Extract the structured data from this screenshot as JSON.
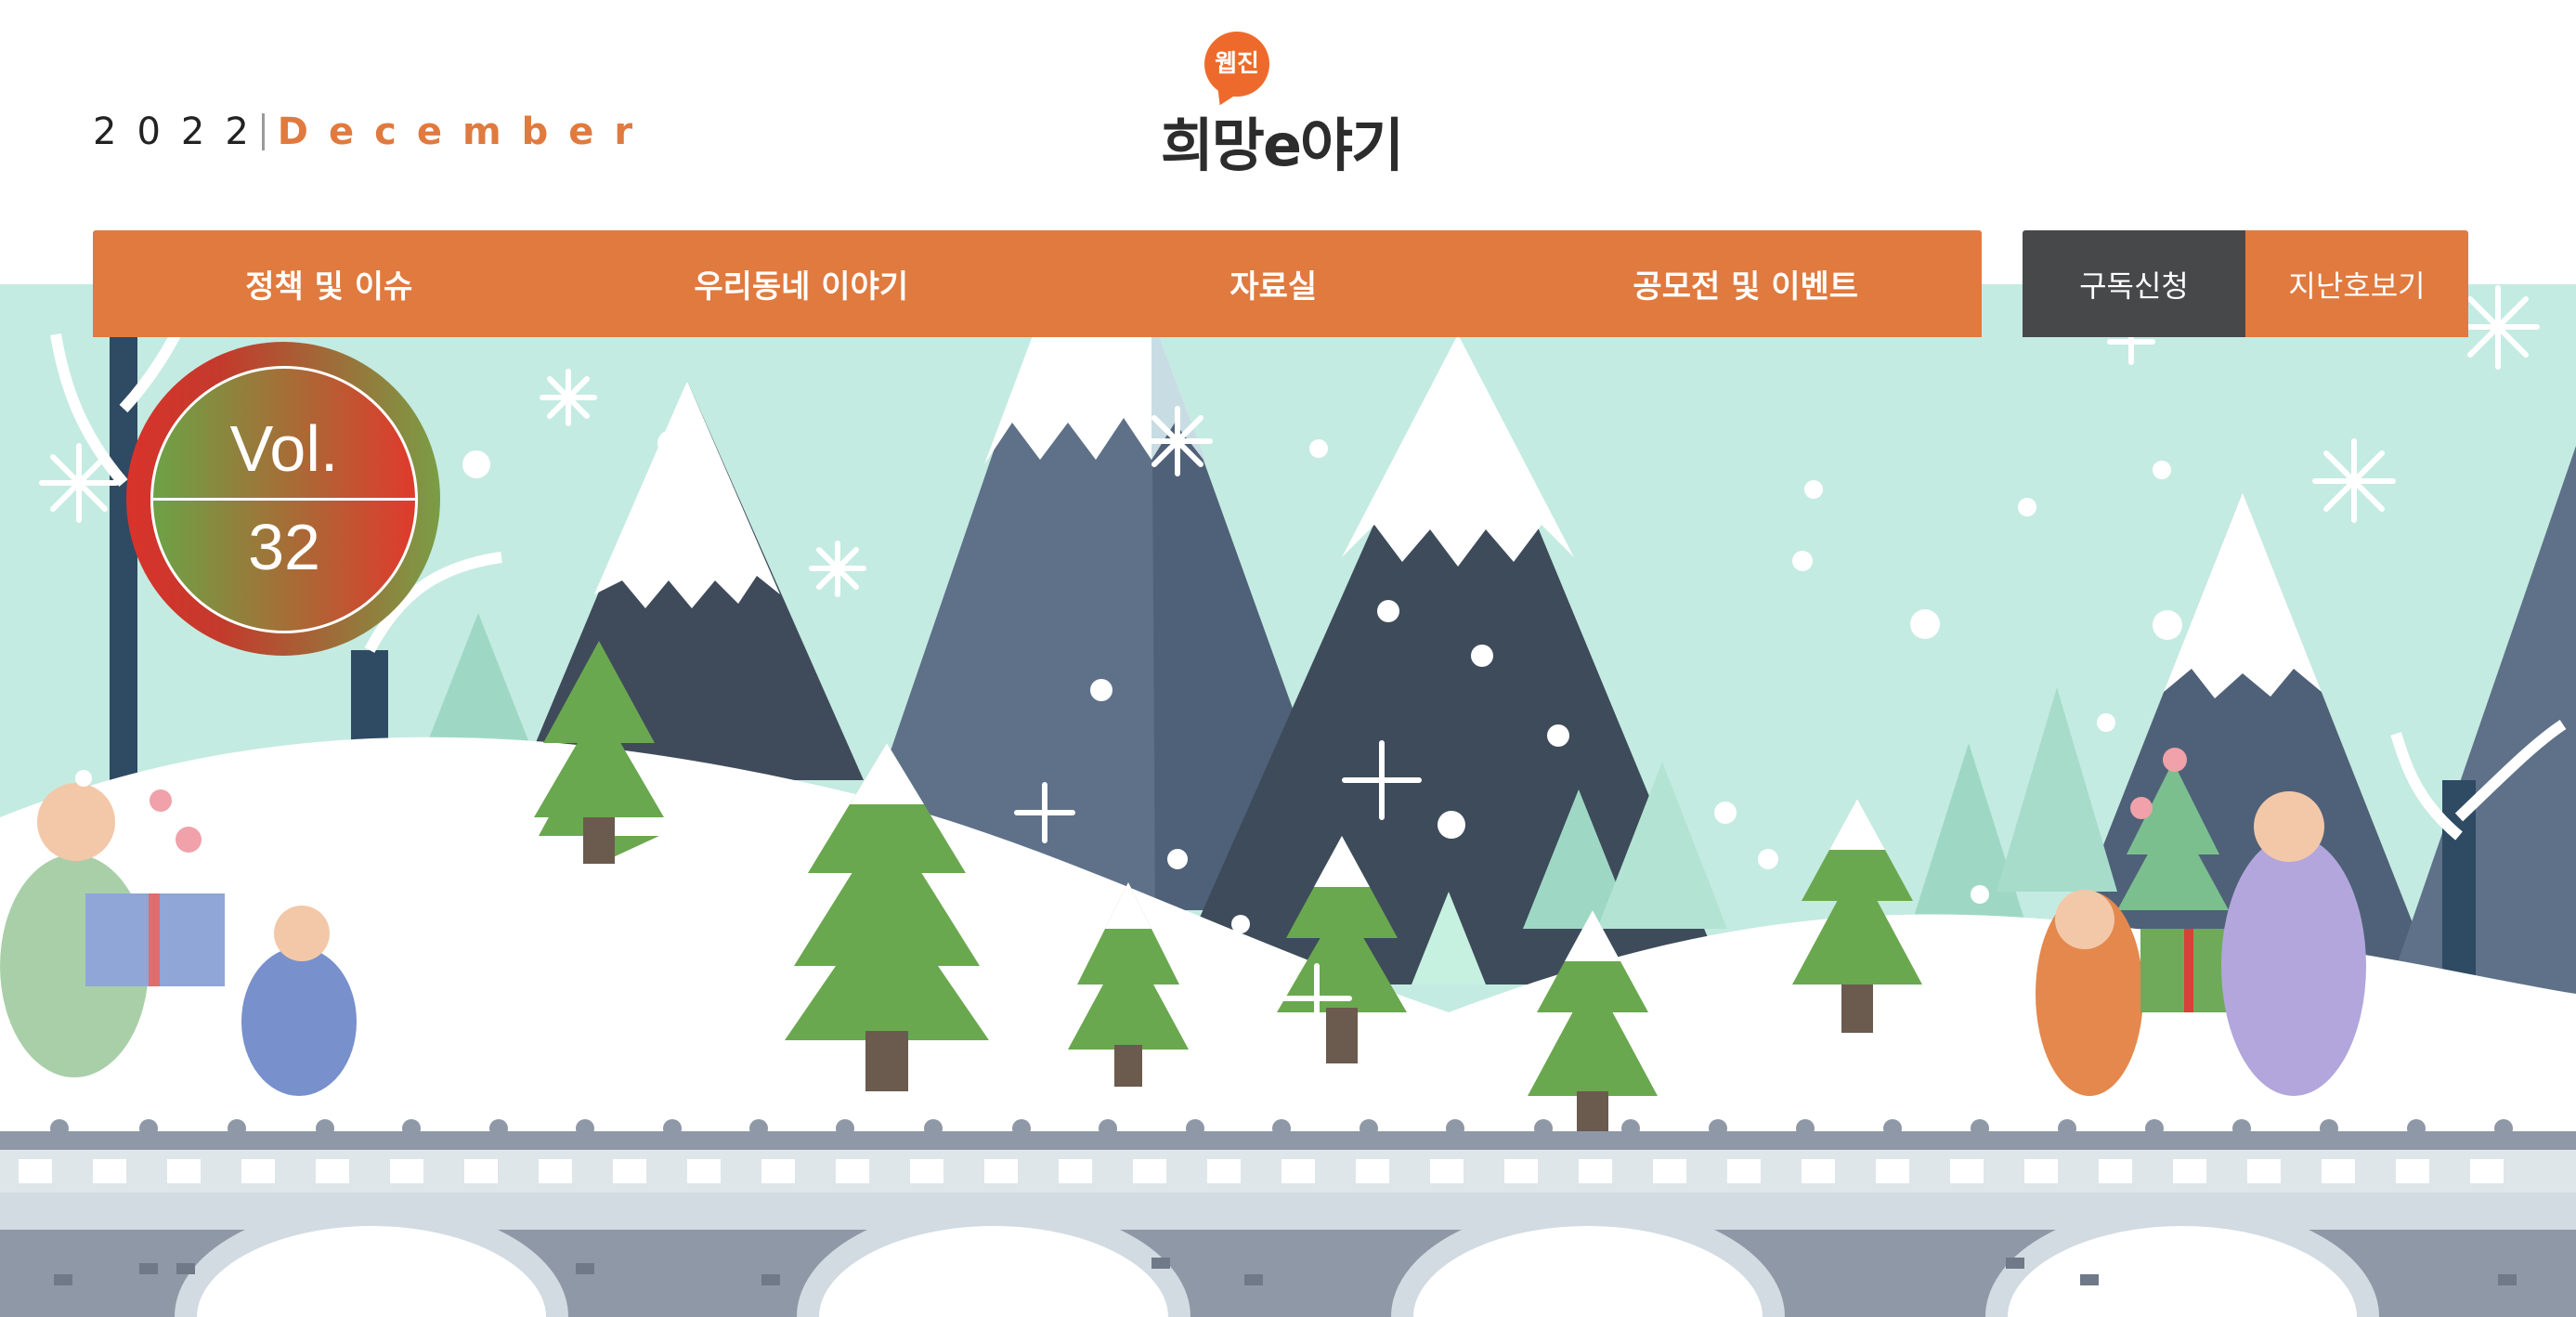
{
  "header": {
    "year": "2022",
    "month": "December",
    "logo_badge": "웹진",
    "logo_title": "희망e야기"
  },
  "nav": {
    "items": [
      {
        "label": "정책 및 이슈"
      },
      {
        "label": "우리동네 이야기"
      },
      {
        "label": "자료실"
      },
      {
        "label": "공모전 및 이벤트"
      }
    ],
    "subscribe_label": "구독신청",
    "archive_label": "지난호보기"
  },
  "banner": {
    "vol_label": "Vol.",
    "vol_number": "32"
  },
  "colors": {
    "accent": "#e07a3f",
    "dark_button": "#474849",
    "sky": "#c4ebe1",
    "logo_bubble": "#ee6a2c"
  }
}
